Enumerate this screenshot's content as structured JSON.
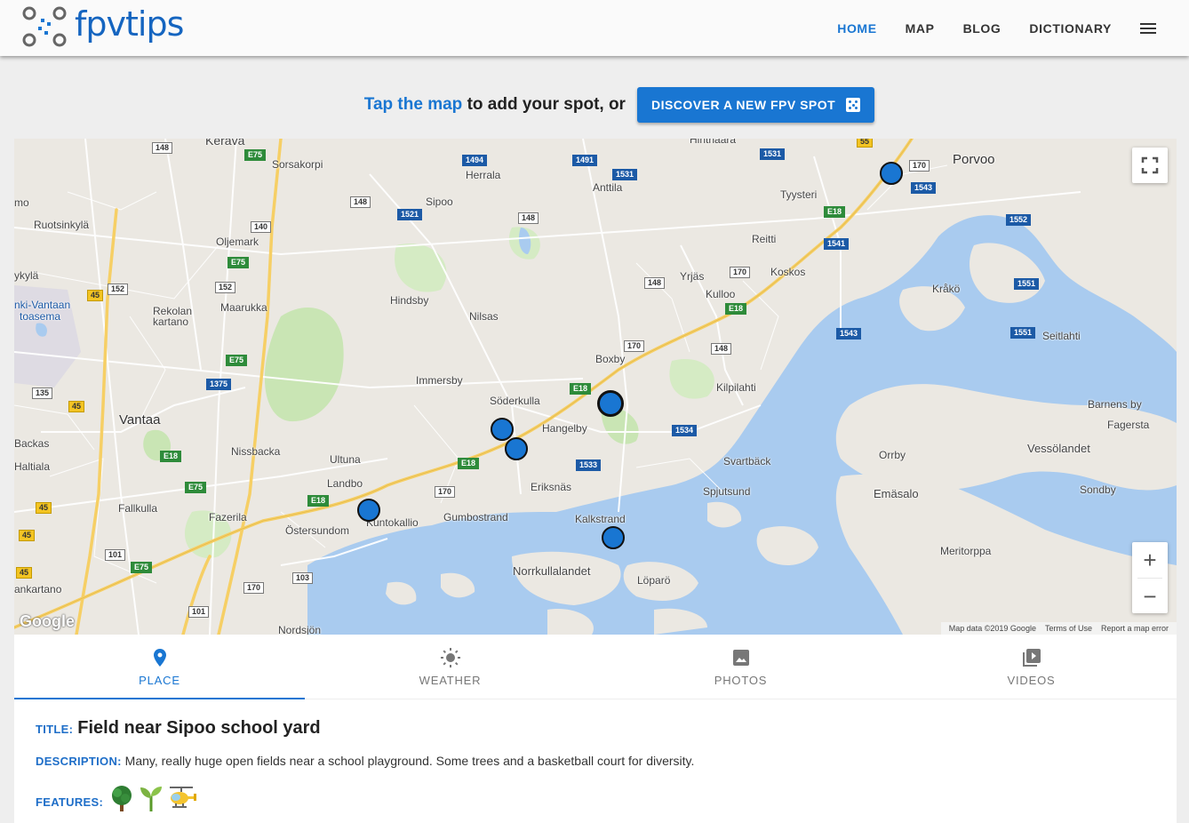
{
  "header": {
    "logo_text": "fpvtips",
    "nav": [
      {
        "label": "HOME",
        "active": true
      },
      {
        "label": "MAP",
        "active": false
      },
      {
        "label": "BLOG",
        "active": false
      },
      {
        "label": "DICTIONARY",
        "active": false
      }
    ],
    "menu_icon": "hamburger-menu-icon"
  },
  "cta": {
    "link_text": "Tap the map",
    "text": "to add your spot, or",
    "button_label": "DISCOVER A NEW FPV SPOT",
    "button_icon": "dice-icon"
  },
  "map": {
    "places": [
      "Kerava",
      "Sorsakorpi",
      "Herrala",
      "Anttila",
      "Hinthaara",
      "Porvoo",
      "Tyysteri",
      "mo",
      "Ruotsinkylä",
      "Sipoo",
      "Oljemark",
      "Reitti",
      "Yrjäs",
      "Koskos",
      "Kråkö",
      "ykylä",
      "Hindsby",
      "Kulloo",
      "nki-Vantaan",
      "toasema",
      "Rekolan",
      "kartano",
      "Maarukka",
      "Nilsas",
      "Boxby",
      "Seitlahti",
      "Immersby",
      "Kilpilahti",
      "Söderkulla",
      "Barnens by",
      "Vantaa",
      "Hangelby",
      "Fagersta",
      "Backas",
      "Nissbacka",
      "Vessölandet",
      "Haltiala",
      "Ultuna",
      "Svartbäck",
      "Orrby",
      "Eriksnäs",
      "Landbo",
      "Spjutsund",
      "Emäsalo",
      "Sondby",
      "Fallkulla",
      "Gumbostrand",
      "Fazerila",
      "Kuntokallio",
      "Kalkstrand",
      "Östersundom",
      "Meritorppa",
      "Norrkullalandet",
      "Löparö",
      "ankartano",
      "Nordsjön"
    ],
    "road_labels": [
      "148",
      "E75",
      "1494",
      "1491",
      "1531",
      "1531",
      "55",
      "170",
      "1543",
      "1521",
      "148",
      "148",
      "140",
      "E18",
      "1552",
      "E75",
      "1541",
      "152",
      "152",
      "170",
      "148",
      "E18",
      "45",
      "1551",
      "1543",
      "1551",
      "170",
      "E75",
      "148",
      "1375",
      "135",
      "E18",
      "45",
      "1534",
      "E18",
      "1533",
      "E18",
      "170",
      "E75",
      "E18",
      "45",
      "45",
      "101",
      "E75",
      "103",
      "45",
      "170",
      "101"
    ],
    "zoom_in": "+",
    "zoom_out": "−",
    "google_logo": "Google",
    "attribution": [
      "Map data ©2019 Google",
      "Terms of Use",
      "Report a map error"
    ]
  },
  "tabs": [
    {
      "label": "PLACE",
      "icon": "location-pin-icon",
      "active": true
    },
    {
      "label": "WEATHER",
      "icon": "sun-icon",
      "active": false
    },
    {
      "label": "PHOTOS",
      "icon": "photo-icon",
      "active": false
    },
    {
      "label": "VIDEOS",
      "icon": "video-library-icon",
      "active": false
    }
  ],
  "spot": {
    "title_label": "TITLE:",
    "title": "Field near Sipoo school yard",
    "description_label": "DESCRIPTION:",
    "description": "Many, really huge open fields near a school playground. Some trees and a basketball court for diversity.",
    "features_label": "FEATURES:",
    "features": [
      "tree-icon",
      "seedling-icon",
      "helicopter-icon"
    ]
  },
  "colors": {
    "accent": "#1976d2",
    "marker": "#1976d2",
    "water": "#a9cbef",
    "park": "#c9e5b4",
    "highway": "#f6cf65"
  }
}
